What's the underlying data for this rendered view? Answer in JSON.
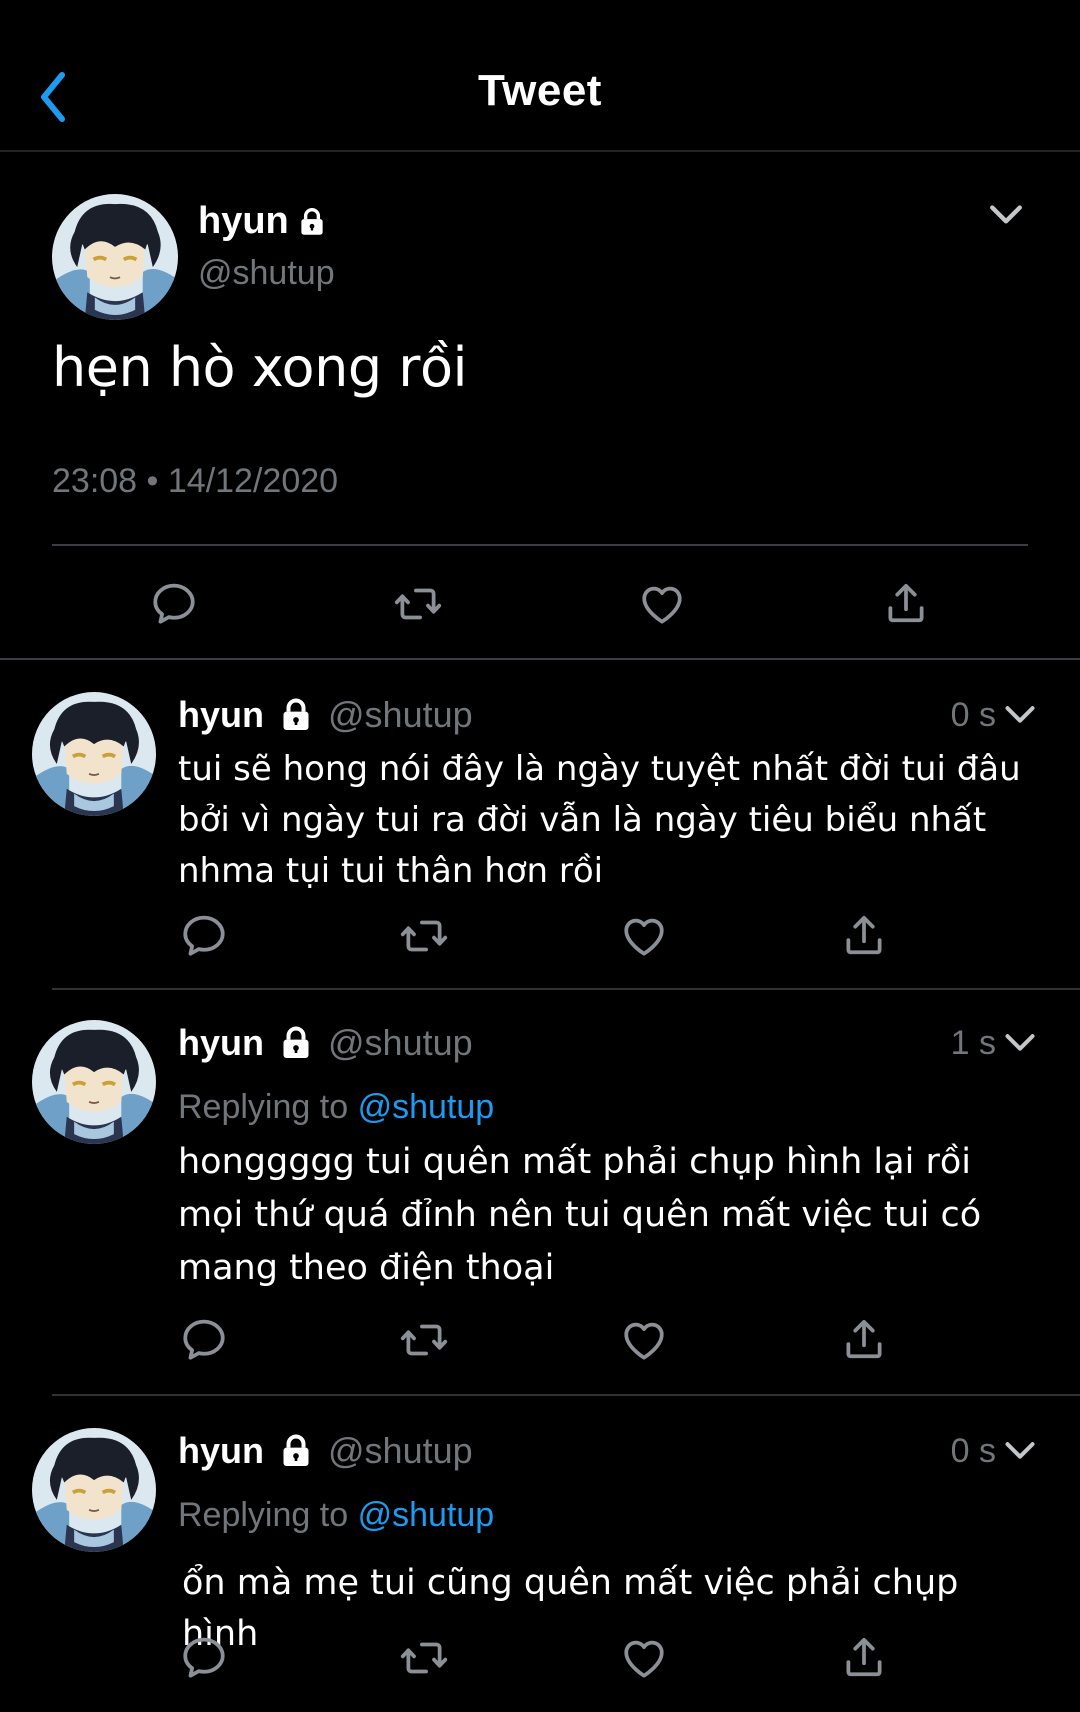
{
  "header": {
    "title": "Tweet"
  },
  "main_tweet": {
    "name": "hyun",
    "handle": "@shutup",
    "text": "hẹn hò xong rồi",
    "timestamp": "23:08 • 14/12/2020"
  },
  "replies": [
    {
      "name": "hyun",
      "handle": "@shutup",
      "time": "0 s",
      "text": "tui sẽ hong nói đây là ngày tuyệt nhất đời tui đâu bởi vì ngày tui ra đời vẫn là ngày tiêu biểu nhất nhma tụi tui thân hơn rồi"
    },
    {
      "name": "hyun",
      "handle": "@shutup",
      "time": "1 s",
      "replying_prefix": "Replying to",
      "replying_to": "@shutup",
      "text": "honggggg tui quên mất phải chụp hình lại rồi mọi thứ quá đỉnh nên tui quên mất việc tui có mang theo điện thoại"
    },
    {
      "name": "hyun",
      "handle": "@shutup",
      "time": "0 s",
      "replying_prefix": "Replying to",
      "replying_to": "@shutup",
      "text": "ổn mà mẹ tui cũng quên mất việc phải chụp hình"
    }
  ],
  "icons": {
    "back": "chevron-left-icon",
    "menu": "chevron-down-icon",
    "reply": "speech-bubble-icon",
    "retweet": "retweet-icon",
    "like": "heart-icon",
    "share": "share-icon",
    "lock": "lock-icon"
  },
  "colors": {
    "background": "#000000",
    "accent": "#1d9bf0",
    "text": "#ffffff",
    "muted": "#71767b",
    "divider": "#2f3336"
  }
}
